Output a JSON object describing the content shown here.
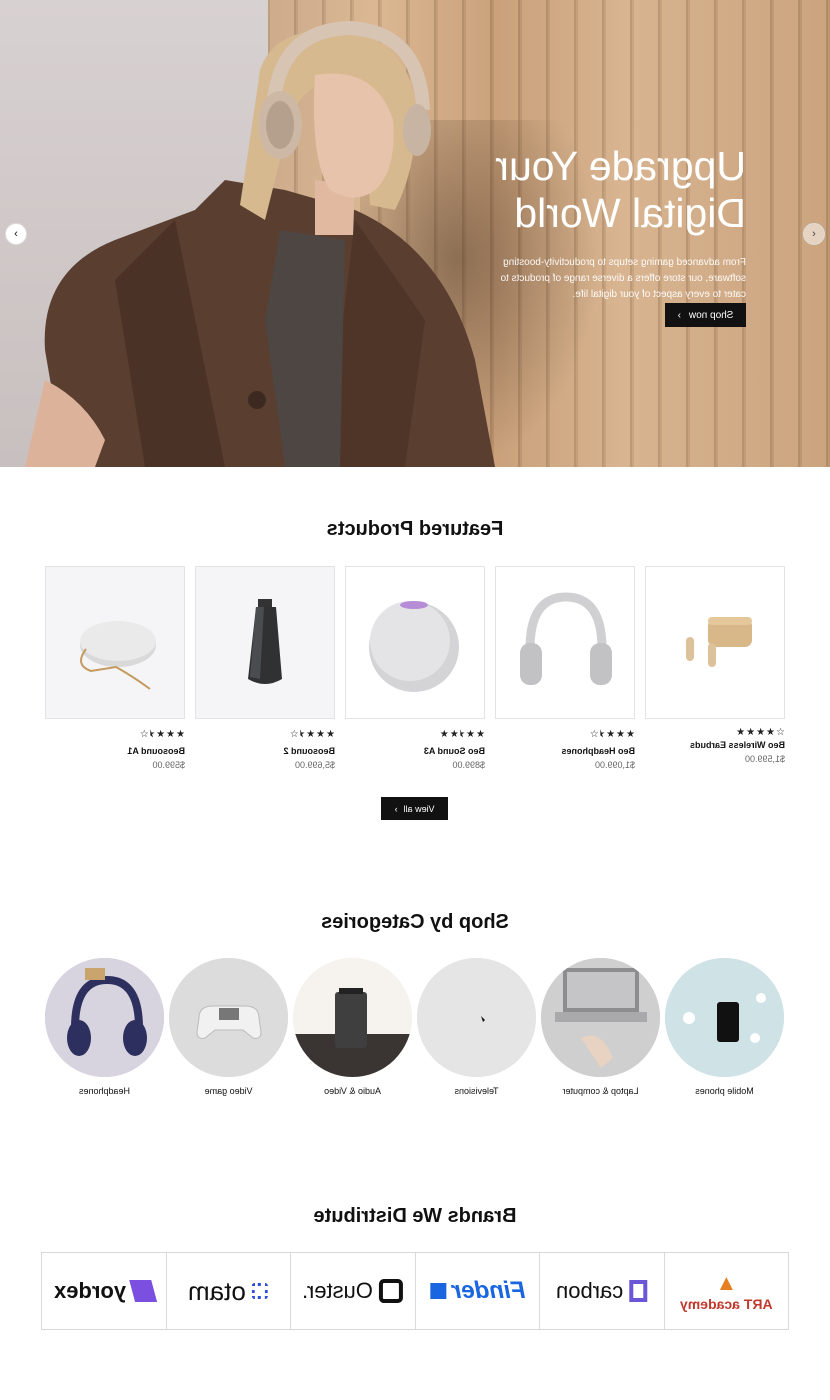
{
  "hero": {
    "title_line1": "Upgrade Your",
    "title_line2": "Digital World",
    "subtitle": "From advanced gaming setups to productivity-boosting software, our store offers a diverse range of products to cater to every aspect of your digital life.",
    "button_label": "Shop now"
  },
  "featured": {
    "title": "Featured Products",
    "view_all_label": "View all",
    "products": [
      {
        "name": "Beosound A1",
        "price": "$599.00",
        "rating": 3.5
      },
      {
        "name": "Beosound 2",
        "price": "$5,699.00",
        "rating": 3.5
      },
      {
        "name": "Beo Sound A3",
        "price": "$899.00",
        "rating": 4.5
      },
      {
        "name": "Beo Headphones",
        "price": "$1,099.00",
        "rating": 3.5
      },
      {
        "name": "Beo Wireless Earbuds",
        "price": "$1,599.00",
        "rating": 4
      }
    ]
  },
  "categories": {
    "title": "Shop by Categories",
    "items": [
      {
        "label": "Headphones"
      },
      {
        "label": "Video game"
      },
      {
        "label": "Audio & Video"
      },
      {
        "label": "Televisions"
      },
      {
        "label": "Laptop & computer"
      },
      {
        "label": "Mobile phones"
      }
    ]
  },
  "brands": {
    "title": "Brands We Distribute",
    "items": [
      {
        "label": "yordex",
        "icon": "yordex-logo"
      },
      {
        "label": "otam",
        "icon": "otam-logo"
      },
      {
        "label": "Ouster.",
        "icon": "ouster-logo"
      },
      {
        "label": "Finder",
        "icon": "finder-logo"
      },
      {
        "label": "carbon",
        "icon": "carbon-logo"
      },
      {
        "label": "ART academy",
        "icon": "art-academy-logo"
      }
    ]
  }
}
